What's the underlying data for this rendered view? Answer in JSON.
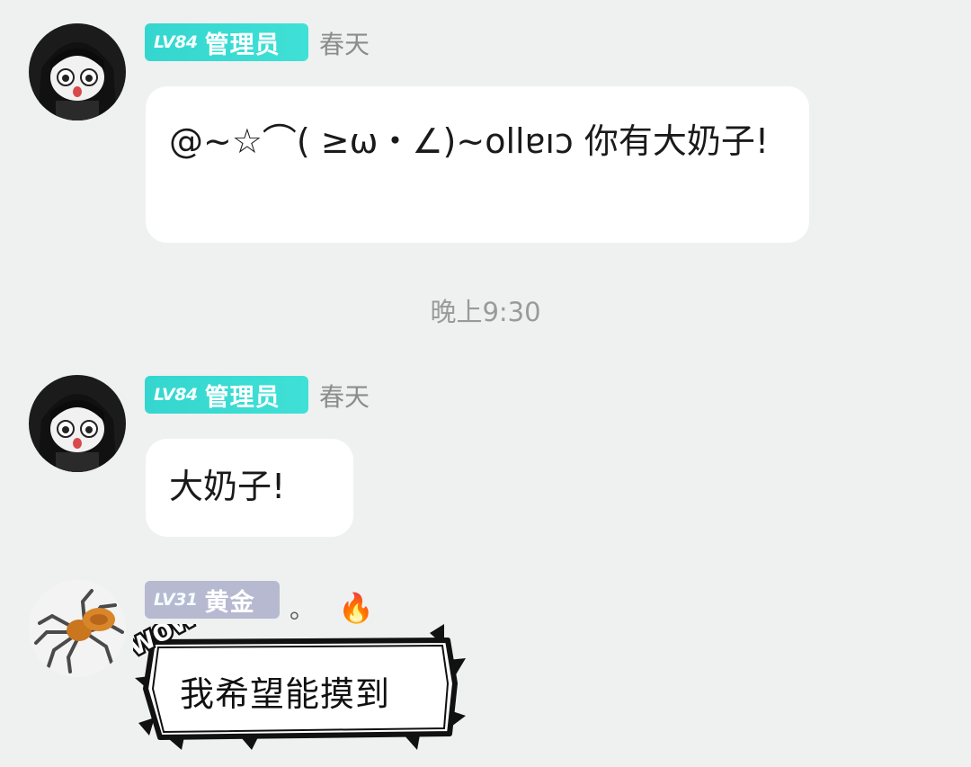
{
  "messages": [
    {
      "level": "LV84",
      "role": "管理员",
      "username": "春天",
      "text": "@~☆⌒( ≥ω・∠)~ollɐıɔ 你有大奶子!"
    },
    {
      "level": "LV84",
      "role": "管理员",
      "username": "春天",
      "text": "大奶子!"
    },
    {
      "level": "LV31",
      "role": "黄金",
      "username": "。",
      "name_emoji": "🔥",
      "sticker_tag": "WOW",
      "text": "我希望能摸到"
    }
  ],
  "timestamp": "晚上9:30",
  "colors": {
    "background": "#eef1f0",
    "admin_badge": "#3fe0d6",
    "gold_badge": "#b6b9d0",
    "bubble": "#ffffff"
  }
}
